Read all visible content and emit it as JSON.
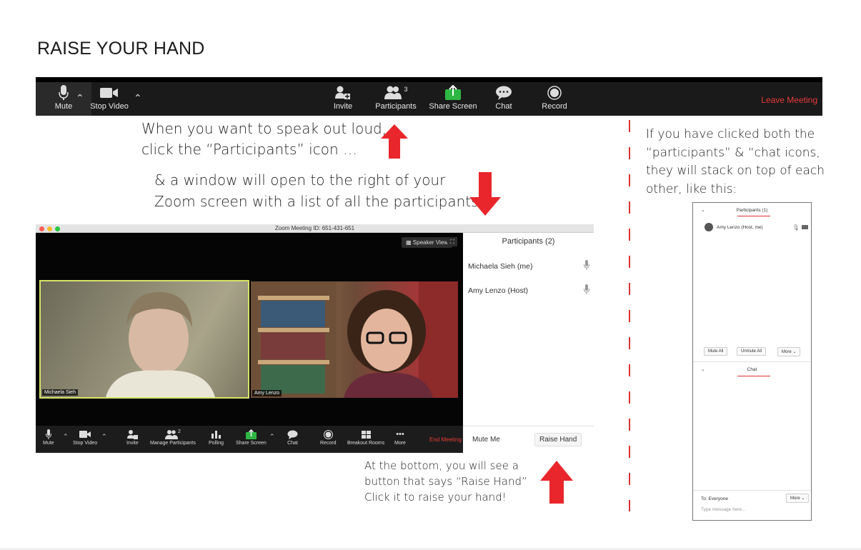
{
  "title": "RAISE YOUR HAND",
  "toolbar": {
    "mute": "Mute",
    "stop_video": "Stop Video",
    "invite": "Invite",
    "participants": "Participants",
    "participants_count": "3",
    "share_screen": "Share Screen",
    "chat": "Chat",
    "record": "Record",
    "leave": "Leave Meeting"
  },
  "instructions": {
    "step1_line1": "When you want to speak out loud,",
    "step1_line2": "click the “Participants” icon …",
    "step2_line1": "& a window will open to the right of your",
    "step2_line2": "Zoom screen with a list of all the participants:",
    "step3_line1": "At the bottom, you will see a",
    "step3_line2": "button that says “Raise Hand”",
    "step3_line3": "Click it to raise your hand!",
    "side_line1": "If you have clicked both the",
    "side_line2": "“participants” & “chat icons,",
    "side_line3": "they will stack on top of each",
    "side_line4": "other, like this:"
  },
  "zoom_window": {
    "title": "Zoom Meeting ID: 651-431-651",
    "speaker_view": "Speaker View",
    "tile1_name": "Michaela Sieh",
    "tile2_name": "Amy Lenzo",
    "controls": {
      "mute": "Mute",
      "stop_video": "Stop Video",
      "invite": "Invite",
      "manage_participants": "Manage Participants",
      "manage_count": "2",
      "polling": "Polling",
      "share_screen": "Share Screen",
      "chat": "Chat",
      "record": "Record",
      "breakout": "Breakout Rooms",
      "more": "More",
      "end": "End Meeting"
    },
    "panel": {
      "title": "Participants (2)",
      "p1": "Michaela Sieh (me)",
      "p2": "Amy Lenzo (Host)",
      "mute_me": "Mute Me",
      "raise_hand": "Raise Hand"
    }
  },
  "stack_panel": {
    "participants_title": "Participants (1)",
    "participant": "Amy Lenzo (Host, me)",
    "mute_all": "Mute All",
    "unmute_all": "Unmute All",
    "more": "More",
    "chat_title": "Chat",
    "to": "To: Everyone",
    "more2": "More",
    "placeholder": "Type message here..."
  },
  "colors": {
    "arrow": "#e8262b",
    "leave": "#e83a3a",
    "share_green": "#2fb744",
    "active_border": "#d7e36a"
  }
}
